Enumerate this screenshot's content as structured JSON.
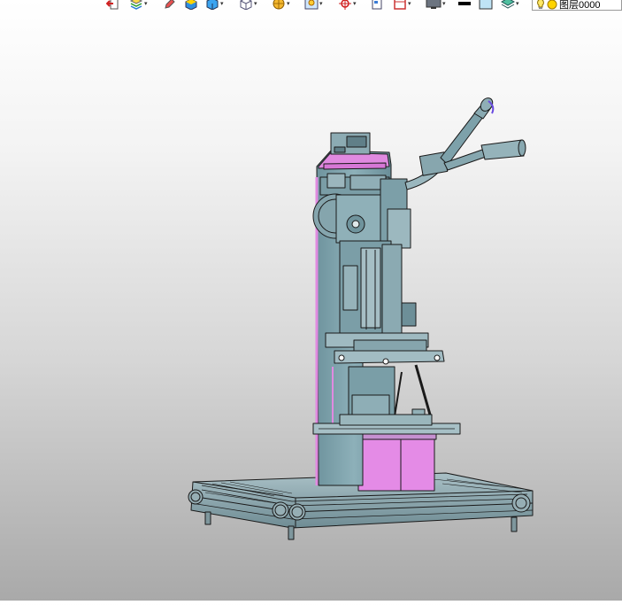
{
  "toolbar": {
    "layer_label": "图层0000",
    "colors": {
      "line_color": "#000000",
      "fill_color": "#bfe3f5"
    },
    "buttons": [
      {
        "name": "exit-icon"
      },
      {
        "name": "layer-stack-icon",
        "dropdown": true
      },
      {
        "name": "pencil-icon"
      },
      {
        "name": "box-color-icon"
      },
      {
        "name": "solid-cube-icon",
        "dropdown": true
      },
      {
        "name": "wireframe-cube-icon",
        "dropdown": true
      },
      {
        "name": "sphere-icon",
        "dropdown": true
      },
      {
        "name": "lightbulb-frame-icon",
        "dropdown": true
      },
      {
        "name": "target-icon",
        "dropdown": true
      },
      {
        "name": "page-icon"
      },
      {
        "name": "frame-icon",
        "dropdown": true
      },
      {
        "name": "monitor-icon",
        "dropdown": true
      },
      {
        "name": "line-color-swatch"
      },
      {
        "name": "fill-color-swatch"
      },
      {
        "name": "layers-icon",
        "dropdown": true
      },
      {
        "name": "lightbulb-icon"
      },
      {
        "name": "sun-icon"
      }
    ]
  },
  "viewport": {
    "model_colors": {
      "body": "#7fa3ad",
      "highlight": "#e08ae0",
      "outline": "#1a1a1a"
    }
  }
}
